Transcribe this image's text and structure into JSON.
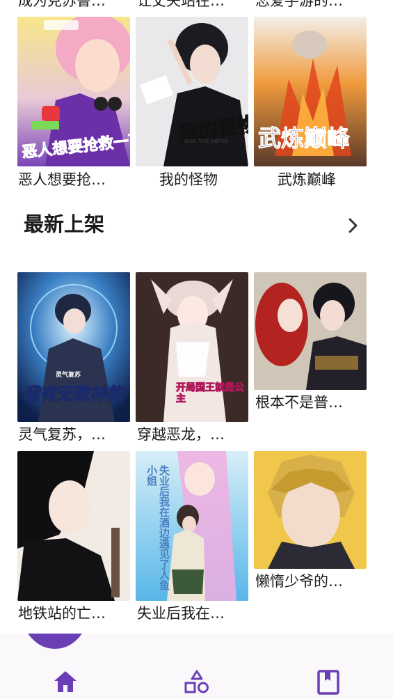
{
  "top_partial_titles": [
    "成为克苏鲁…",
    "让丈夫站在…",
    "恋爱手游的…"
  ],
  "row1": [
    {
      "title": "恶人想要抢…",
      "cover_text": "恶人想要抢救一下",
      "icon": "manga-cover"
    },
    {
      "title": "我的怪物",
      "cover_text": "我的怪物",
      "cover_subtext": "KISS THE ABYSS",
      "icon": "manga-cover"
    },
    {
      "title": "武炼巅峰",
      "cover_text": "武炼巅峰",
      "icon": "manga-cover"
    }
  ],
  "section": {
    "title": "最新上架",
    "more_icon": "chevron-right-icon"
  },
  "row2": [
    {
      "title": "灵气复苏，…",
      "cover_text": "我有无数神能",
      "cover_subtext": "灵气复苏",
      "icon": "manga-cover"
    },
    {
      "title": "穿越恶龙，…",
      "cover_text": "开局国王就是公主",
      "icon": "manga-cover"
    },
    {
      "title": "根本不是普…",
      "icon": "manga-cover"
    }
  ],
  "row3": [
    {
      "title": "地铁站的亡…",
      "icon": "manga-cover"
    },
    {
      "title": "失业后我在…",
      "cover_text": "失业后我在酒边遇见了人鱼小姐",
      "icon": "manga-cover"
    },
    {
      "title": "懒惰少爷的…",
      "icon": "manga-cover"
    }
  ],
  "bottom_nav": {
    "items": [
      {
        "icon": "home-icon",
        "active": true
      },
      {
        "icon": "category-shapes-icon",
        "active": false
      },
      {
        "icon": "bookmark-book-icon",
        "active": false
      }
    ],
    "accent": "#6a3fb5"
  }
}
